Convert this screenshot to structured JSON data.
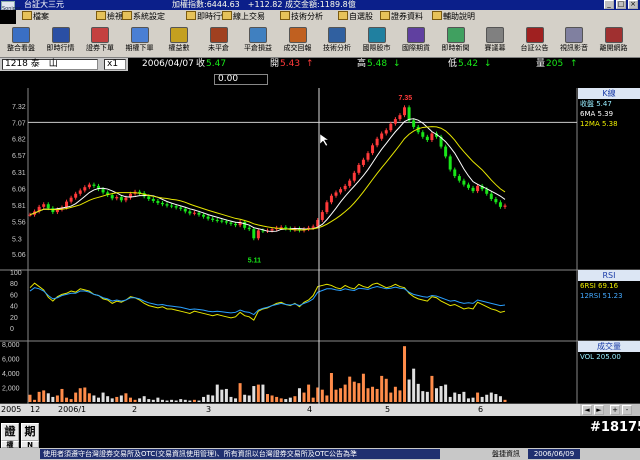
{
  "window": {
    "title": "台証大三元",
    "index_text": "加權指數:6444.63　+112.82 成交金額:1189.8億",
    "app_icon": "Soniper"
  },
  "menu": [
    "檔案",
    "檢視",
    "系統設定",
    "即時行情",
    "線上交易",
    "技術分析",
    "自選股",
    "證券資料",
    "輔助說明"
  ],
  "toolbar": [
    {
      "label": "整合看盤",
      "icon": "dashboard-icon",
      "color": "#3a6fc4"
    },
    {
      "label": "即時行情",
      "icon": "list-icon",
      "color": "#2a4fa4"
    },
    {
      "label": "證券下單",
      "icon": "order-icon",
      "color": "#c44040"
    },
    {
      "label": "期權下單",
      "icon": "option-icon",
      "color": "#4a7fd4"
    },
    {
      "label": "權益數",
      "icon": "coins-icon",
      "color": "#c4a020"
    },
    {
      "label": "未平倉",
      "icon": "position-icon",
      "color": "#a04020"
    },
    {
      "label": "平倉損益",
      "icon": "pnl-icon",
      "color": "#4080c0"
    },
    {
      "label": "成交回報",
      "icon": "report-icon",
      "color": "#c06020"
    },
    {
      "label": "技術分析",
      "icon": "chart-icon",
      "color": "#3060a0"
    },
    {
      "label": "國際股市",
      "icon": "globe-icon",
      "color": "#2080a0"
    },
    {
      "label": "國際期貨",
      "icon": "futures-icon",
      "color": "#6040a0"
    },
    {
      "label": "即時新聞",
      "icon": "news-icon",
      "color": "#40a060"
    },
    {
      "label": "賽議幕",
      "icon": "screen-icon",
      "color": "#808080"
    },
    {
      "label": "台証公告",
      "icon": "notice-icon",
      "color": "#a02020"
    },
    {
      "label": "視訊影音",
      "icon": "video-icon",
      "color": "#8080a0"
    },
    {
      "label": "離開網路",
      "icon": "exit-icon",
      "color": "#a03030"
    }
  ],
  "quote": {
    "symbol": "1218 泰　山",
    "period": "x1",
    "date": "2006/04/07",
    "close_label": "收",
    "close": "5.47",
    "open_label": "開",
    "open": "5.43",
    "high_label": "高",
    "high": "5.48",
    "low_label": "低",
    "low": "5.42",
    "vol_label": "量",
    "vol": "205"
  },
  "info_input": "0.00",
  "price_axis": [
    "7.32",
    "7.07",
    "6.82",
    "6.57",
    "6.31",
    "6.06",
    "5.81",
    "5.56",
    "5.3",
    "5.06"
  ],
  "rsi_axis": [
    "100",
    "80",
    "60",
    "40",
    "20",
    "0"
  ],
  "vol_axis": [
    "8,000",
    "6,000",
    "4,000",
    "2,000"
  ],
  "price_annotations": {
    "high": "7.35",
    "low": "5.11"
  },
  "legend_k": {
    "title": "K線",
    "close": "收盤 5.47",
    "ma6": "6MA 5.39",
    "ma12": "12MA 5.38"
  },
  "legend_rsi": {
    "title": "RSI",
    "rsi6": "6RSI 69.16",
    "rsi12": "12RSI 51.23"
  },
  "legend_vol": {
    "title": "成交量",
    "vol": "VOL 205.00"
  },
  "date_axis": [
    "2005",
    "12",
    "2006/1",
    "2",
    "3",
    "4",
    "5",
    "6"
  ],
  "bottom_buttons": [
    "證",
    "期",
    "權",
    "N"
  ],
  "status": {
    "disclaimer": "使用者須遵守台灣證券交易所及OTC(交易資訊使用管理)、所有資訊以台灣證券交易所及OTC公告為準",
    "source": "盤捷資訊",
    "date": "2006/06/09"
  },
  "watermark": "#18175",
  "colors": {
    "up": "#ff3a3a",
    "down": "#19e619",
    "ma6": "#ffffff",
    "ma12": "#e6e600",
    "rsi6": "#e6e600",
    "rsi12": "#2aa0ff",
    "vol_up": "#ff8c4a",
    "vol_down": "#e0e0e0"
  },
  "chart_data": {
    "type": "line",
    "close": [
      5.66,
      5.71,
      5.78,
      5.82,
      5.76,
      5.7,
      5.74,
      5.77,
      5.86,
      5.92,
      5.98,
      6.03,
      6.08,
      6.12,
      6.1,
      6.05,
      6.0,
      5.96,
      5.91,
      5.93,
      5.88,
      5.92,
      5.98,
      6.01,
      5.99,
      5.94,
      5.9,
      5.87,
      5.84,
      5.82,
      5.8,
      5.79,
      5.77,
      5.75,
      5.71,
      5.68,
      5.69,
      5.66,
      5.63,
      5.6,
      5.58,
      5.57,
      5.56,
      5.54,
      5.52,
      5.5,
      5.55,
      5.46,
      5.44,
      5.3,
      5.42,
      5.41,
      5.42,
      5.44,
      5.46,
      5.47,
      5.45,
      5.43,
      5.45,
      5.42,
      5.44,
      5.46,
      5.48,
      5.58,
      5.7,
      5.85,
      5.95,
      6.0,
      6.05,
      6.1,
      6.18,
      6.3,
      6.42,
      6.5,
      6.6,
      6.72,
      6.82,
      6.9,
      6.95,
      7.05,
      7.12,
      7.18,
      7.3,
      7.1,
      7.0,
      6.92,
      6.85,
      6.8,
      6.9,
      6.85,
      6.7,
      6.55,
      6.35,
      6.25,
      6.18,
      6.12,
      6.07,
      6.02,
      6.1,
      6.05,
      5.98,
      5.9,
      5.85,
      5.78,
      5.8
    ],
    "rsi6": [
      72,
      80,
      74,
      68,
      55,
      48,
      56,
      60,
      62,
      66,
      64,
      70,
      68,
      66,
      60,
      58,
      52,
      50,
      44,
      48,
      46,
      50,
      56,
      54,
      50,
      44,
      40,
      38,
      36,
      38,
      34,
      34,
      32,
      30,
      28,
      26,
      30,
      28,
      26,
      24,
      22,
      24,
      22,
      20,
      18,
      20,
      28,
      22,
      20,
      14,
      30,
      34,
      36,
      40,
      44,
      46,
      42,
      40,
      44,
      38,
      46,
      50,
      58,
      74,
      76,
      78,
      76,
      72,
      70,
      76,
      72,
      70,
      78,
      74,
      72,
      78,
      80,
      76,
      72,
      74,
      78,
      74,
      72,
      62,
      56,
      52,
      50,
      48,
      56,
      54,
      48,
      44,
      40,
      42,
      38,
      34,
      36,
      34,
      46,
      42,
      38,
      34,
      32,
      28,
      30
    ],
    "rsi12": [
      66,
      72,
      70,
      66,
      58,
      52,
      54,
      58,
      60,
      62,
      62,
      66,
      66,
      64,
      60,
      58,
      54,
      52,
      48,
      50,
      48,
      50,
      54,
      54,
      52,
      48,
      45,
      43,
      41,
      42,
      40,
      39,
      38,
      37,
      35,
      33,
      34,
      33,
      32,
      30,
      29,
      30,
      29,
      28,
      27,
      28,
      32,
      29,
      28,
      24,
      32,
      35,
      37,
      40,
      42,
      44,
      42,
      41,
      43,
      40,
      44,
      47,
      52,
      64,
      67,
      70,
      70,
      68,
      67,
      70,
      68,
      67,
      71,
      70,
      69,
      72,
      74,
      72,
      70,
      71,
      73,
      71,
      70,
      64,
      60,
      58,
      56,
      55,
      58,
      57,
      54,
      51,
      48,
      49,
      46,
      44,
      45,
      44,
      50,
      48,
      46,
      44,
      42,
      40,
      41
    ],
    "volume": [
      1000,
      300,
      1400,
      1600,
      1200,
      700,
      900,
      1800,
      600,
      400,
      1300,
      1900,
      2000,
      1200,
      900,
      600,
      1300,
      800,
      500,
      700,
      900,
      1200,
      600,
      300,
      500,
      800,
      400,
      300,
      600,
      300,
      200,
      300,
      200,
      400,
      300,
      200,
      300,
      200,
      700,
      1000,
      900,
      2400,
      1700,
      1800,
      700,
      500,
      2600,
      1000,
      900,
      2200,
      2400,
      2400,
      1100,
      900,
      700,
      500,
      400,
      600,
      800,
      1900,
      1300,
      2400,
      600,
      2000,
      1700,
      900,
      4000,
      1700,
      1900,
      2400,
      3500,
      2800,
      2600,
      3900,
      1900,
      2100,
      1800,
      3600,
      3200,
      1300,
      2100,
      1600,
      7700,
      3100,
      4600,
      2500,
      1500,
      1400,
      3600,
      1900,
      2200,
      2400,
      700,
      1300,
      1100,
      1400,
      500,
      600,
      1300,
      700,
      1000,
      1300,
      1100,
      800,
      300
    ],
    "ylim_price": [
      5.06,
      7.32
    ],
    "ylim_rsi": [
      0,
      100
    ],
    "ylim_vol": [
      0,
      8000
    ],
    "xlabel": "",
    "ylabel": ""
  }
}
